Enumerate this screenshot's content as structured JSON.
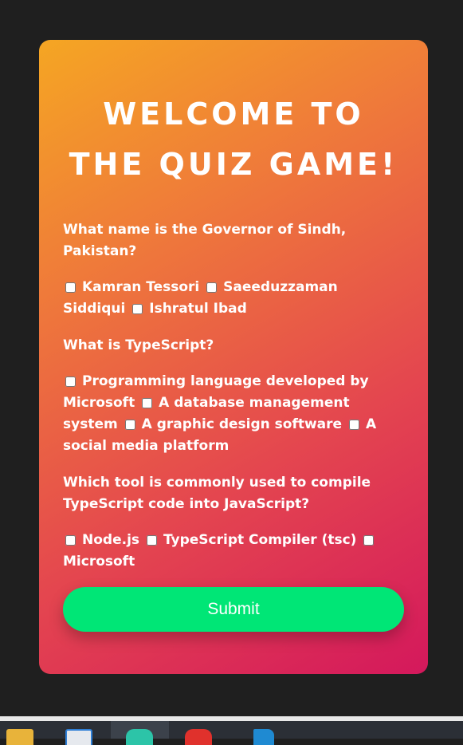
{
  "quiz": {
    "title": "Welcome to the Quiz Game!",
    "questions": [
      {
        "text": "What name is the Governor of Sindh, Pakistan?",
        "options": [
          "Kamran Tessori",
          "Saeeduzzaman Siddiqui",
          "Ishratul Ibad"
        ]
      },
      {
        "text": "What is TypeScript?",
        "options": [
          "Programming language developed by Microsoft",
          "A database management system",
          "A graphic design software",
          "A social media platform"
        ]
      },
      {
        "text": "Which tool is commonly used to compile TypeScript code into JavaScript?",
        "options": [
          "Node.js",
          "TypeScript Compiler (tsc)",
          "Microsoft"
        ]
      }
    ],
    "submit_label": "Submit"
  },
  "colors": {
    "page_background": "#1f1f1f",
    "card_gradient_start": "#f5a623",
    "card_gradient_end": "#d4185c",
    "submit_button": "#00e676",
    "text": "#ffffff"
  },
  "taskbar": {
    "icons": [
      "file-explorer-icon",
      "store-icon",
      "edge-browser-icon",
      "chrome-browser-icon",
      "vscode-icon"
    ]
  }
}
